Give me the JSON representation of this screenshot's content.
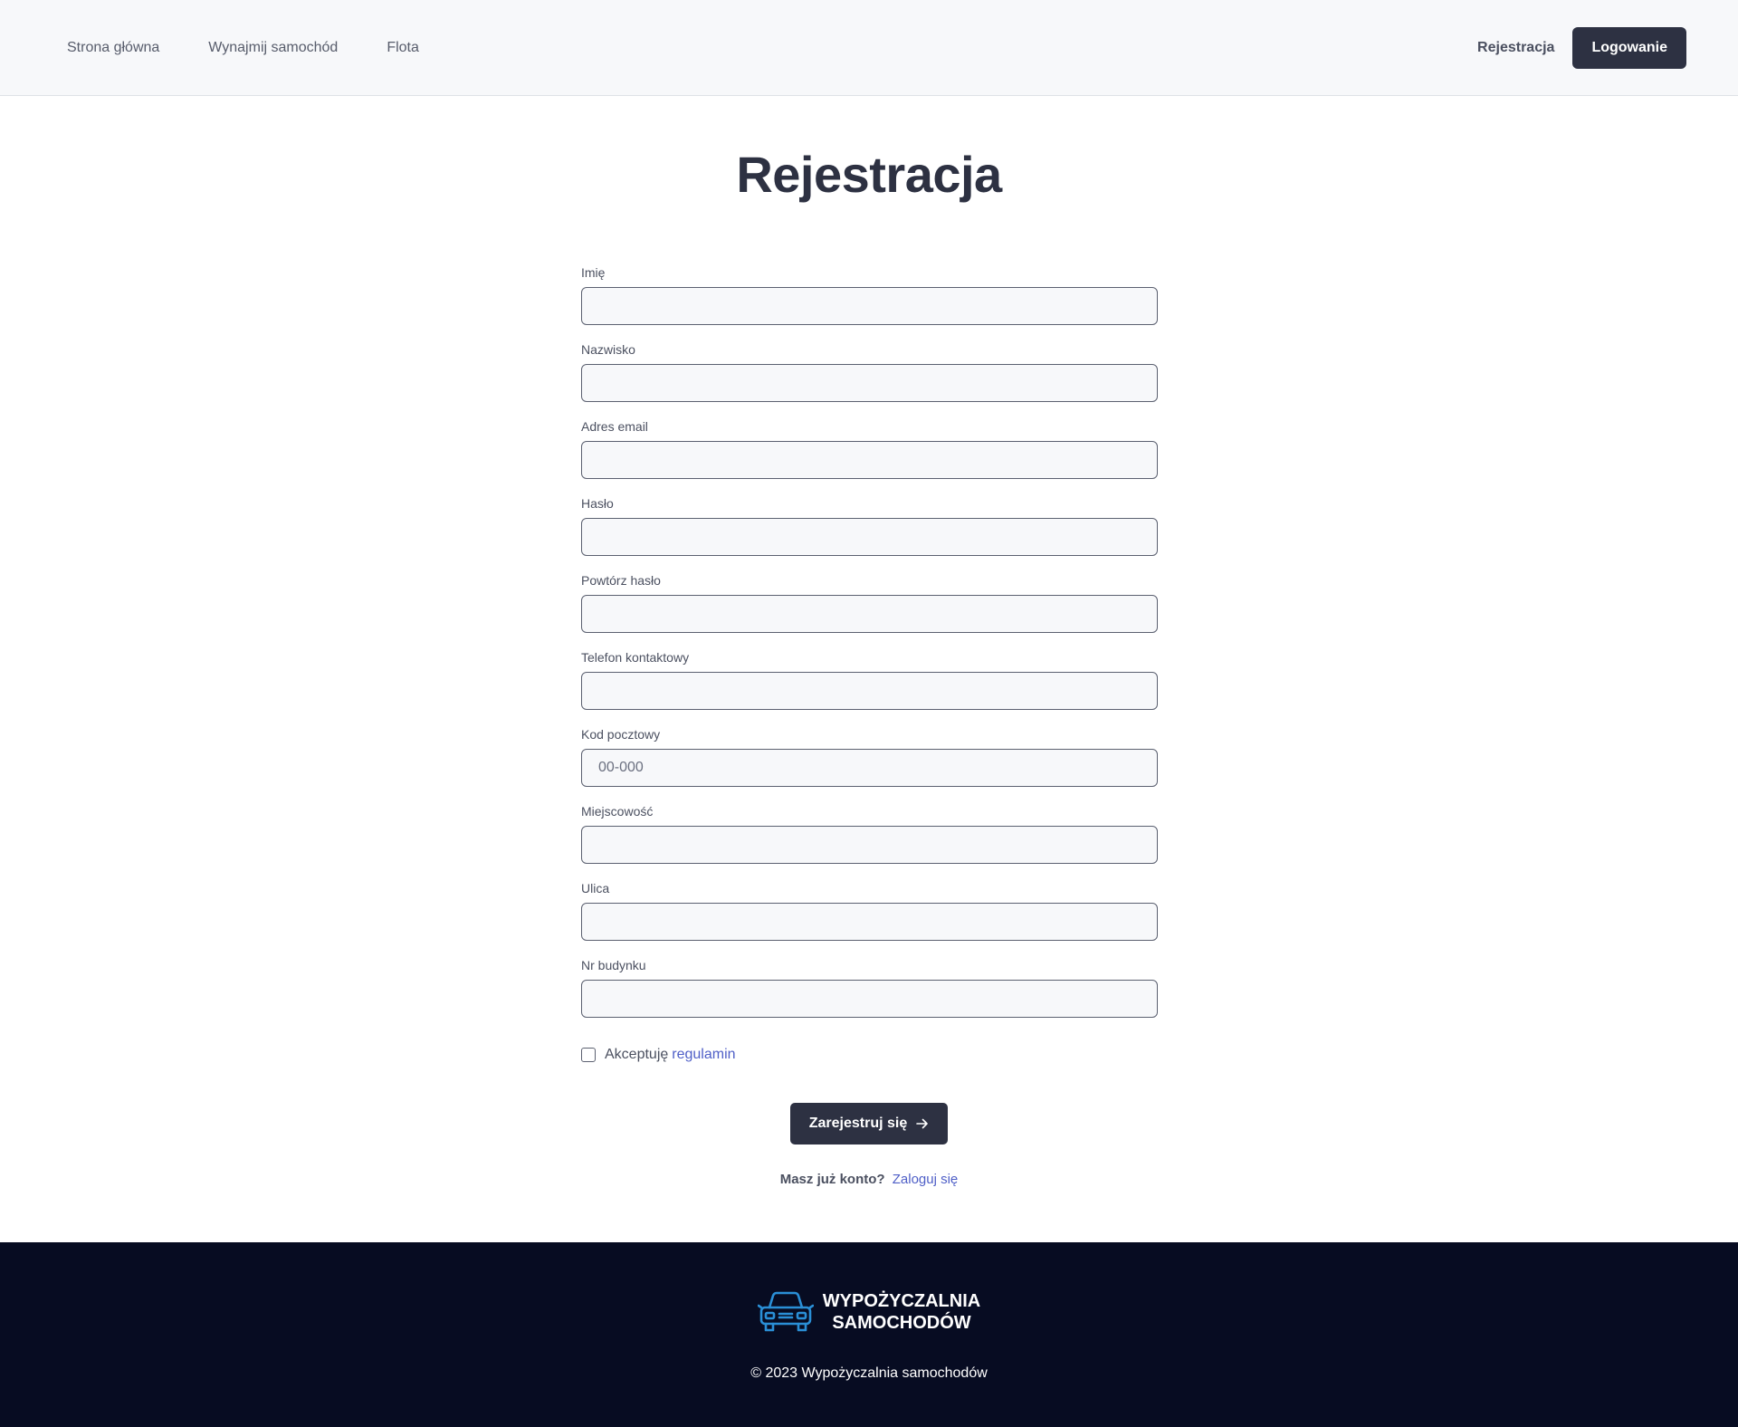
{
  "nav": {
    "links": [
      "Strona główna",
      "Wynajmij samochód",
      "Flota"
    ],
    "register_label": "Rejestracja",
    "login_label": "Logowanie"
  },
  "page": {
    "title": "Rejestracja"
  },
  "form": {
    "fields": [
      {
        "label": "Imię",
        "value": "",
        "placeholder": ""
      },
      {
        "label": "Nazwisko",
        "value": "",
        "placeholder": ""
      },
      {
        "label": "Adres email",
        "value": "",
        "placeholder": ""
      },
      {
        "label": "Hasło",
        "value": "",
        "placeholder": ""
      },
      {
        "label": "Powtórz hasło",
        "value": "",
        "placeholder": ""
      },
      {
        "label": "Telefon kontaktowy",
        "value": "",
        "placeholder": ""
      },
      {
        "label": "Kod pocztowy",
        "value": "",
        "placeholder": "00-000"
      },
      {
        "label": "Miejscowość",
        "value": "",
        "placeholder": ""
      },
      {
        "label": "Ulica",
        "value": "",
        "placeholder": ""
      },
      {
        "label": "Nr budynku",
        "value": "",
        "placeholder": ""
      }
    ],
    "terms_prefix": "Akceptuję",
    "terms_link": "regulamin",
    "terms_checked": false,
    "submit_label": "Zarejestruj się",
    "submit_icon": "arrow-right-icon",
    "login_question": "Masz już konto?",
    "login_link": "Zaloguj się"
  },
  "footer": {
    "logo_icon": "car-icon",
    "brand_line1": "WYPOŻYCZALNIA",
    "brand_line2": "SAMOCHODÓW",
    "copyright": "© 2023 Wypożyczalnia samochodów"
  },
  "colors": {
    "primary_dark": "#2d3142",
    "link_blue": "#4f5fc7",
    "footer_bg": "#070c22",
    "logo_blue": "#2a8fd6",
    "header_bg": "#f7f8fa"
  }
}
